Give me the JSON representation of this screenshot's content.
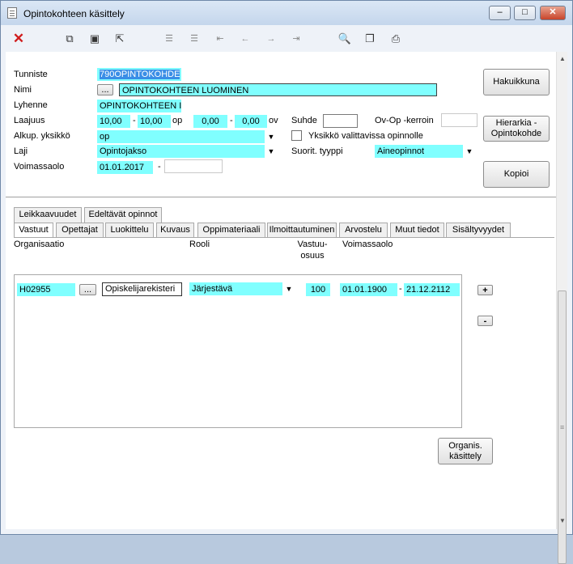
{
  "window": {
    "title": "Opintokohteen käsittely"
  },
  "window_controls": {
    "minimize": "–",
    "maximize": "□",
    "close": "✕"
  },
  "toolbar": {
    "icons": [
      "delete-icon",
      "copy-icon",
      "save-icon",
      "export-icon",
      "add-row-icon",
      "remove-row-icon",
      "first-icon",
      "prev-icon",
      "next-icon",
      "last-icon",
      "search-icon",
      "documents-icon",
      "print-icon"
    ]
  },
  "form": {
    "tunniste_label": "Tunniste",
    "tunniste_value": "790OPINTOKOHDE",
    "nimi_label": "Nimi",
    "nimi_button": "...",
    "nimi_value": "OPINTOKOHTEEN LUOMINEN",
    "lyhenne_label": "Lyhenne",
    "lyhenne_value": "OPINTOKOHTEEN I",
    "laajuus_label": "Laajuus",
    "laajuus_op_min": "10,00",
    "laajuus_dash1": "-",
    "laajuus_op_max": "10,00",
    "laajuus_op_unit": "op",
    "laajuus_ov_min": "0,00",
    "laajuus_dash2": "-",
    "laajuus_ov_max": "0,00",
    "laajuus_ov_unit": "ov",
    "suhde_label": "Suhde",
    "suhde_value": "",
    "ovop_label": "Ov-Op -kerroin",
    "ovop_value": "",
    "alkup_label": "Alkup. yksikkö",
    "alkup_value": "op",
    "yksikko_check_label": "Yksikkö valittavissa opinnolle",
    "laji_label": "Laji",
    "laji_value": "Opintojakso",
    "suorit_label": "Suorit. tyyppi",
    "suorit_value": "Aineopinnot",
    "voimassaolo_label": "Voimassaolo",
    "voimassaolo_start": "01.01.2017",
    "voimassaolo_dash": "-",
    "voimassaolo_end": ""
  },
  "side_buttons": {
    "hakuikkuna": "Hakuikkuna",
    "hierarkia_line1": "Hierarkia -",
    "hierarkia_line2": "Opintokohde",
    "kopioi": "Kopioi"
  },
  "tabs_row1": [
    "Leikkaavuudet",
    "Edeltävät opinnot"
  ],
  "tabs_row2": [
    "Vastuut",
    "Opettajat",
    "Luokittelu",
    "Kuvaus",
    "Oppimateriaali",
    "Ilmoittautuminen",
    "Arvostelu",
    "Muut tiedot",
    "Sisältyvyydet"
  ],
  "vastuut": {
    "col_organisaatio": "Organisaatio",
    "col_rooli": "Rooli",
    "col_vastuuosuus_line1": "Vastuu-",
    "col_vastuuosuus_line2": "osuus",
    "col_voimassaolo": "Voimassaolo",
    "row": {
      "organisaatio": "H02955",
      "lookup_button": "...",
      "org_name": "Opiskelijarekisteri",
      "rooli": "Järjestävä",
      "osuus": "100",
      "alku": "01.01.1900",
      "dash": "-",
      "loppu": "21.12.2112"
    },
    "add_button": "+",
    "remove_button": "-",
    "organis_line1": "Organis.",
    "organis_line2": "käsittely"
  }
}
